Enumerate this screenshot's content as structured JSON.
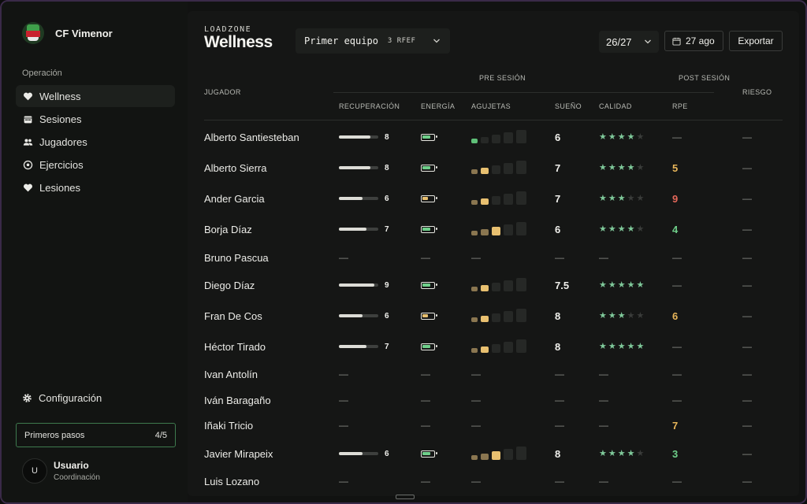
{
  "club": {
    "name": "CF Vimenor"
  },
  "sidebar": {
    "section_label": "Operación",
    "items": [
      {
        "label": "Wellness",
        "icon": "heart-icon",
        "active": true
      },
      {
        "label": "Sesiones",
        "icon": "calendar-icon",
        "active": false
      },
      {
        "label": "Jugadores",
        "icon": "users-icon",
        "active": false
      },
      {
        "label": "Ejercicios",
        "icon": "ball-icon",
        "active": false
      },
      {
        "label": "Lesiones",
        "icon": "heart-icon",
        "active": false
      }
    ],
    "config_label": "Configuración",
    "steps": {
      "label": "Primeros pasos",
      "progress": "4/5"
    },
    "user": {
      "initial": "U",
      "name": "Usuario",
      "role": "Coordinación"
    }
  },
  "header": {
    "brand_small": "LOADZONE",
    "brand_big": "Wellness",
    "team": {
      "name": "Primer equipo",
      "tag": "3 RFEF"
    },
    "season": "26/27",
    "date": "27 ago",
    "export_label": "Exportar"
  },
  "table": {
    "group_pre": "PRE SESIÓN",
    "group_post": "POST SESIÓN",
    "col_player": "JUGADOR",
    "col_risk": "RIESGO",
    "columns": [
      "RECUPERACIÓN",
      "ENERGÍA",
      "AGUJETAS",
      "SUEÑO",
      "CALIDAD",
      "RPE"
    ],
    "dash": "—",
    "rows": [
      {
        "name": "Alberto Santiesteban",
        "rec": 8,
        "energy": 0.8,
        "energy_color": "#6fcf8a",
        "doms": 1,
        "doms_color": "#5fbf78",
        "sleep": "6",
        "stars": 4,
        "rpe": "",
        "rpe_color": "",
        "risk": ""
      },
      {
        "name": "Alberto Sierra",
        "rec": 8,
        "energy": 0.8,
        "energy_color": "#6fcf8a",
        "doms": 2,
        "doms_color": "#e8c070",
        "sleep": "7",
        "stars": 4,
        "rpe": "5",
        "rpe_color": "#e8b65a",
        "risk": ""
      },
      {
        "name": "Ander Garcia",
        "rec": 6,
        "energy": 0.5,
        "energy_color": "#e8c070",
        "doms": 2,
        "doms_color": "#e8c070",
        "sleep": "7",
        "stars": 3,
        "rpe": "9",
        "rpe_color": "#e5685a",
        "risk": ""
      },
      {
        "name": "Borja Díaz",
        "rec": 7,
        "energy": 0.8,
        "energy_color": "#6fcf8a",
        "doms": 3,
        "doms_color": "#e8c070",
        "sleep": "6",
        "stars": 4,
        "rpe": "4",
        "rpe_color": "#6fcf8a",
        "risk": ""
      },
      {
        "name": "Bruno Pascua",
        "rec": null
      },
      {
        "name": "Diego Díaz",
        "rec": 9,
        "energy": 0.8,
        "energy_color": "#6fcf8a",
        "doms": 2,
        "doms_color": "#e8c070",
        "sleep": "7.5",
        "stars": 5,
        "rpe": "",
        "rpe_color": "",
        "risk": ""
      },
      {
        "name": "Fran De Cos",
        "rec": 6,
        "energy": 0.5,
        "energy_color": "#e8c070",
        "doms": 2,
        "doms_color": "#e8c070",
        "sleep": "8",
        "stars": 3,
        "rpe": "6",
        "rpe_color": "#e8b65a",
        "risk": ""
      },
      {
        "name": "Héctor Tirado",
        "rec": 7,
        "energy": 0.8,
        "energy_color": "#6fcf8a",
        "doms": 2,
        "doms_color": "#e8c070",
        "sleep": "8",
        "stars": 5,
        "rpe": "",
        "rpe_color": "",
        "risk": ""
      },
      {
        "name": "Ivan Antolín",
        "rec": null
      },
      {
        "name": "Iván Baragaño",
        "rec": null
      },
      {
        "name": "Iñaki Tricio",
        "rec": null,
        "rpe": "7",
        "rpe_color": "#e8b65a"
      },
      {
        "name": "Javier Mirapeix",
        "rec": 6,
        "energy": 0.8,
        "energy_color": "#6fcf8a",
        "doms": 3,
        "doms_color": "#e8c070",
        "sleep": "8",
        "stars": 4,
        "rpe": "3",
        "rpe_color": "#6fcf8a",
        "risk": ""
      },
      {
        "name": "Luis Lozano",
        "rec": null
      }
    ]
  },
  "colors": {
    "accent_green": "#6fcf8a",
    "warning_yellow": "#e8b65a",
    "danger_red": "#e5685a",
    "star_on": "#7fc99a",
    "star_off": "#3a3c3a"
  }
}
